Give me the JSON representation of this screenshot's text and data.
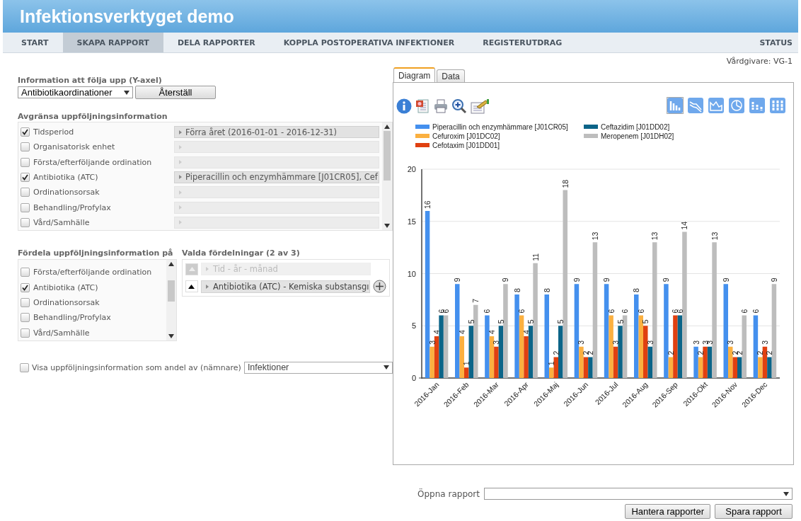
{
  "header": {
    "title": "Infektionsverktyget demo"
  },
  "nav": {
    "items": [
      {
        "label": "START",
        "selected": false
      },
      {
        "label": "SKAPA RAPPORT",
        "selected": true
      },
      {
        "label": "DELA RAPPORTER",
        "selected": false
      },
      {
        "label": "KOPPLA POSTOPERATIVA INFEKTIONER",
        "selected": false
      },
      {
        "label": "REGISTERUTDRAG",
        "selected": false
      }
    ],
    "status": "STATUS"
  },
  "caregiver": "Vårdgivare: VG-1",
  "y_axis": {
    "label": "Information att följa upp (Y-axel)",
    "select_value": "Antibiotikaordinationer",
    "reset_button": "Återställ"
  },
  "filter": {
    "title": "Avgränsa uppföljningsinformation",
    "items": [
      {
        "label": "Tidsperiod",
        "checked": true,
        "value": "Förra året (2016-01-01 - 2016-12-31)"
      },
      {
        "label": "Organisatorisk enhet",
        "checked": false
      },
      {
        "label": "Första/efterföljande ordination",
        "checked": false
      },
      {
        "label": "Antibiotika (ATC)",
        "checked": true,
        "value": "Piperacillin och enzymhämmare [J01CR05], Cef"
      },
      {
        "label": "Ordinationsorsak",
        "checked": false
      },
      {
        "label": "Behandling/Profylax",
        "checked": false
      },
      {
        "label": "Vård/Samhälle",
        "checked": false
      }
    ]
  },
  "distribute": {
    "title": "Fördela uppföljningsinformation på",
    "items": [
      {
        "label": "Första/efterföljande ordination",
        "checked": false
      },
      {
        "label": "Antibiotika (ATC)",
        "checked": true
      },
      {
        "label": "Ordinationsorsak",
        "checked": false
      },
      {
        "label": "Behandling/Profylax",
        "checked": false
      },
      {
        "label": "Vård/Samhälle",
        "checked": false
      }
    ]
  },
  "chosen": {
    "title": "Valda fördelningar (2 av 3)",
    "items": [
      {
        "label": "Tid - år - månad",
        "disabled": true
      },
      {
        "label": "Antibiotika (ATC) - Kemiska substansgı",
        "disabled": false
      }
    ]
  },
  "share": {
    "label": "Visa uppföljningsinformation som andel av (nämnare)",
    "checked": false,
    "select_value": "Infektioner"
  },
  "tabs": [
    {
      "label": "Diagram",
      "selected": true
    },
    {
      "label": "Data",
      "selected": false
    }
  ],
  "chart_types": [
    {
      "kind": "bar",
      "selected": true
    },
    {
      "kind": "line",
      "selected": false
    },
    {
      "kind": "area",
      "selected": false
    },
    {
      "kind": "pie",
      "selected": false
    },
    {
      "kind": "stacked",
      "selected": false
    },
    {
      "kind": "stacked100",
      "selected": false
    }
  ],
  "chart_data": {
    "type": "bar",
    "categories": [
      "2016-Jan",
      "2016-Feb",
      "2016-Mar",
      "2016-Apr",
      "2016-Maj",
      "2016-Jun",
      "2016-Jul",
      "2016-Aug",
      "2016-Sep",
      "2016-Okt",
      "2016-Nov",
      "2016-Dec"
    ],
    "series": [
      {
        "name": "Piperacillin och enzymhämmare [J01CR05]",
        "color": "#4490ee",
        "values": [
          16,
          9,
          6,
          8,
          8,
          9,
          9,
          8,
          9,
          3,
          9,
          6
        ]
      },
      {
        "name": "Cefuroxim [J01DC02]",
        "color": "#fbb040",
        "values": [
          3,
          4,
          4,
          6,
          1,
          3,
          6,
          6,
          2,
          2,
          3,
          2
        ]
      },
      {
        "name": "Cefotaxim [J01DD01]",
        "color": "#e04010",
        "values": [
          4,
          1,
          3,
          4,
          2,
          2,
          3,
          5,
          6,
          3,
          2,
          3
        ]
      },
      {
        "name": "Ceftazidim [J01DD02]",
        "color": "#0b6488",
        "values": [
          6,
          5,
          5,
          5,
          5,
          2,
          5,
          3,
          6,
          3,
          2,
          2
        ]
      },
      {
        "name": "Meropenem [J01DH02]",
        "color": "#bdbdbd",
        "values": [
          6,
          7,
          9,
          11,
          18,
          13,
          6,
          13,
          14,
          13,
          6,
          9
        ]
      }
    ],
    "ylim": [
      0,
      20
    ],
    "yticks": [
      0,
      5,
      10,
      15,
      20
    ],
    "data_labels": true,
    "grid": true,
    "legend": true
  },
  "open_report": {
    "label": "Öppna rapport"
  },
  "buttons": [
    "Hantera rapporter",
    "Spara rapport"
  ]
}
